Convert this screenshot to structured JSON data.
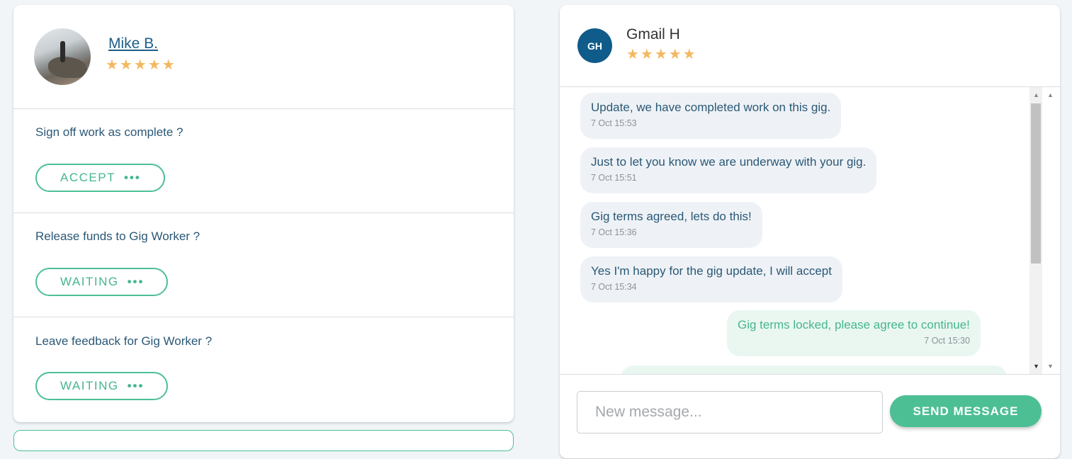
{
  "left_panel": {
    "profile": {
      "name": "Mike B.",
      "stars": "★★★★★"
    },
    "tasks": [
      {
        "question": "Sign off work as complete ?",
        "button_label": "ACCEPT",
        "button_dots": "•••"
      },
      {
        "question": "Release funds to Gig Worker ?",
        "button_label": "WAITING",
        "button_dots": "•••"
      },
      {
        "question": "Leave feedback for Gig Worker ?",
        "button_label": "WAITING",
        "button_dots": "•••"
      }
    ]
  },
  "chat": {
    "header": {
      "initials": "GH",
      "name": "Gmail H",
      "stars": "★★★★★"
    },
    "messages": [
      {
        "direction": "in",
        "text": "Update, we have completed work on this gig.",
        "time": "7 Oct 15:53"
      },
      {
        "direction": "in",
        "text": "Just to let you know we are underway with your gig.",
        "time": "7 Oct 15:51"
      },
      {
        "direction": "in",
        "text": "Gig terms agreed, lets do this!",
        "time": "7 Oct 15:36"
      },
      {
        "direction": "in",
        "text": "Yes I'm happy for the gig update, I will accept",
        "time": "7 Oct 15:34"
      },
      {
        "direction": "out",
        "text": "Gig terms locked, please agree to continue!",
        "time": "7 Oct 15:30"
      }
    ],
    "composer": {
      "placeholder": "New message...",
      "send_label": "SEND MESSAGE"
    }
  },
  "colors": {
    "accent": "#4dbf95",
    "primary_text": "#2b5876",
    "star": "#f4b860",
    "avatar_bg": "#0f5c8a"
  }
}
